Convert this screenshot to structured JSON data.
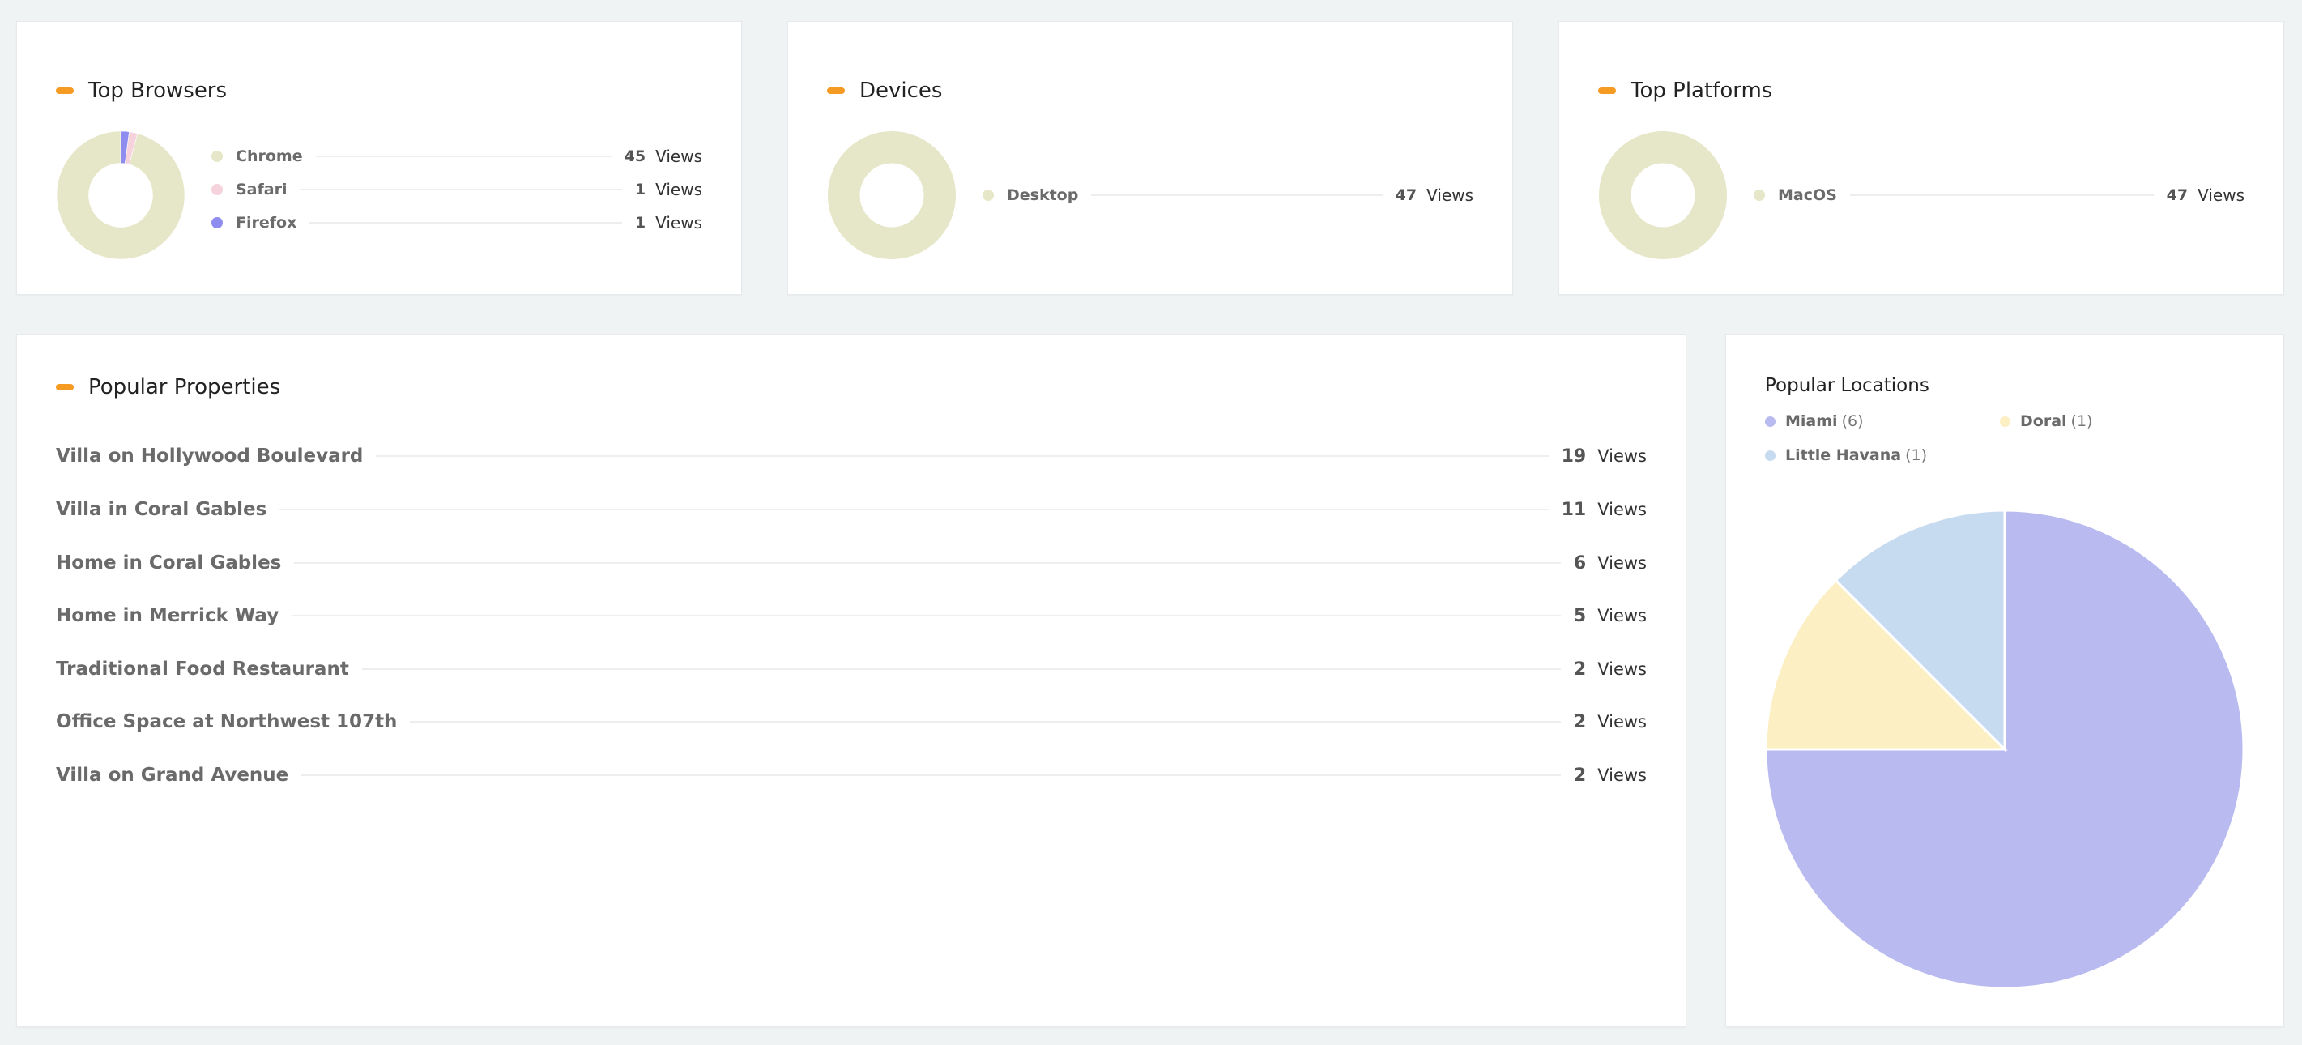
{
  "accent_color": "#f59a23",
  "views_label": "Views",
  "browsers": {
    "title": "Top Browsers",
    "items": [
      {
        "label": "Chrome",
        "count": "45",
        "value": 45,
        "color": "#e6e6c8"
      },
      {
        "label": "Safari",
        "count": "1",
        "value": 1,
        "color": "#f6d2dc"
      },
      {
        "label": "Firefox",
        "count": "1",
        "value": 1,
        "color": "#8f8cf0"
      }
    ]
  },
  "devices": {
    "title": "Devices",
    "items": [
      {
        "label": "Desktop",
        "count": "47",
        "value": 47,
        "color": "#e6e6c8"
      }
    ]
  },
  "platforms": {
    "title": "Top Platforms",
    "items": [
      {
        "label": "MacOS",
        "count": "47",
        "value": 47,
        "color": "#e6e6c8"
      }
    ]
  },
  "properties": {
    "title": "Popular Properties",
    "items": [
      {
        "name": "Villa on Hollywood Boulevard",
        "count": "19"
      },
      {
        "name": "Villa in Coral Gables",
        "count": "11"
      },
      {
        "name": "Home in Coral Gables",
        "count": "6"
      },
      {
        "name": "Home in Merrick Way",
        "count": "5"
      },
      {
        "name": "Traditional Food Restaurant",
        "count": "2"
      },
      {
        "name": "Office Space at Northwest 107th",
        "count": "2"
      },
      {
        "name": "Villa on Grand Avenue",
        "count": "2"
      }
    ]
  },
  "locations": {
    "title": "Popular Locations",
    "legend": [
      {
        "name": "Miami",
        "count": "(6)",
        "color": "#b8baf0"
      },
      {
        "name": "Doral",
        "count": "(1)",
        "color": "#fcefc4"
      },
      {
        "name": "Little Havana",
        "count": "(1)",
        "color": "#c6dbf0"
      }
    ]
  },
  "chart_data": [
    {
      "type": "pie",
      "categories": [
        "Chrome",
        "Safari",
        "Firefox"
      ],
      "values": [
        45,
        1,
        1
      ],
      "title": "Top Browsers"
    },
    {
      "type": "pie",
      "categories": [
        "Desktop"
      ],
      "values": [
        47
      ],
      "title": "Devices"
    },
    {
      "type": "pie",
      "categories": [
        "MacOS"
      ],
      "values": [
        47
      ],
      "title": "Top Platforms"
    },
    {
      "type": "pie",
      "categories": [
        "Miami",
        "Doral",
        "Little Havana"
      ],
      "values": [
        6,
        1,
        1
      ],
      "title": "Popular Locations"
    }
  ]
}
